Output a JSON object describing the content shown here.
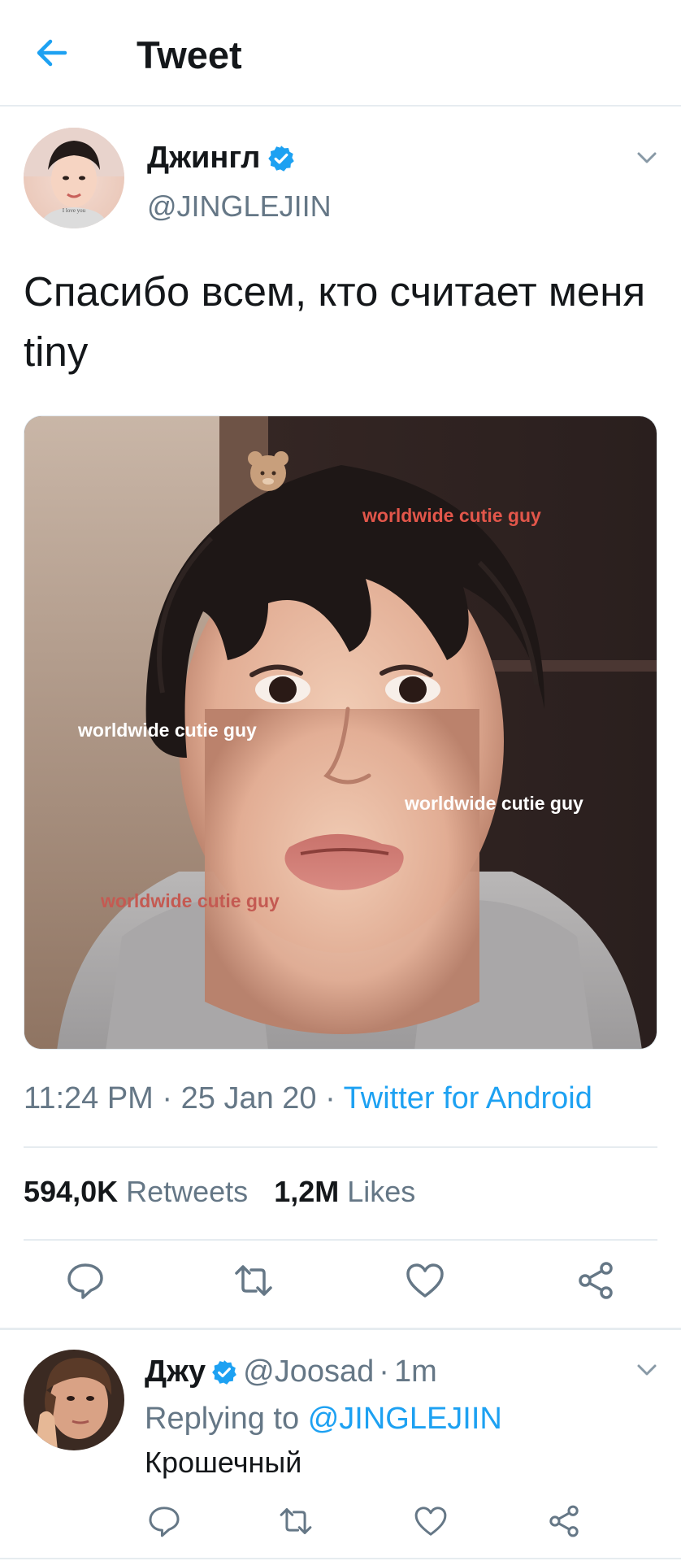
{
  "header": {
    "title": "Tweet"
  },
  "tweet": {
    "author_name": "Джингл",
    "author_handle": "@JINGLEJIIN",
    "text": "Спасибо всем, кто считает меня tiny",
    "image_overlays": [
      "worldwide cutie guy",
      "worldwide cutie guy",
      "worldwide cutie guy",
      "worldwide cutie guy"
    ],
    "avatar_caption": "I love you",
    "time": "11:24 PM",
    "date": "25 Jan 20",
    "separator": "·",
    "source": "Twitter for Android",
    "retweets_count": "594,0K",
    "retweets_label": "Retweets",
    "likes_count": "1,2M",
    "likes_label": "Likes"
  },
  "reply": {
    "name": "Джу",
    "handle": "@Joosad",
    "separator": "·",
    "time": "1m",
    "replying_to_label": "Replying to",
    "replying_to_handle": "@JINGLEJIIN",
    "text": "Крошечный"
  },
  "colors": {
    "accent": "#1da1f2",
    "text_primary": "#14171a",
    "text_secondary": "#657786",
    "divider": "#e6ecf0",
    "overlay_red": "#e2564a",
    "overlay_white": "#ffffff"
  },
  "icons": {
    "back": "arrow-left-icon",
    "verified": "verified-badge-icon",
    "caret": "chevron-down-icon",
    "reply": "reply-icon",
    "retweet": "retweet-icon",
    "like": "heart-icon",
    "share": "share-icon"
  }
}
